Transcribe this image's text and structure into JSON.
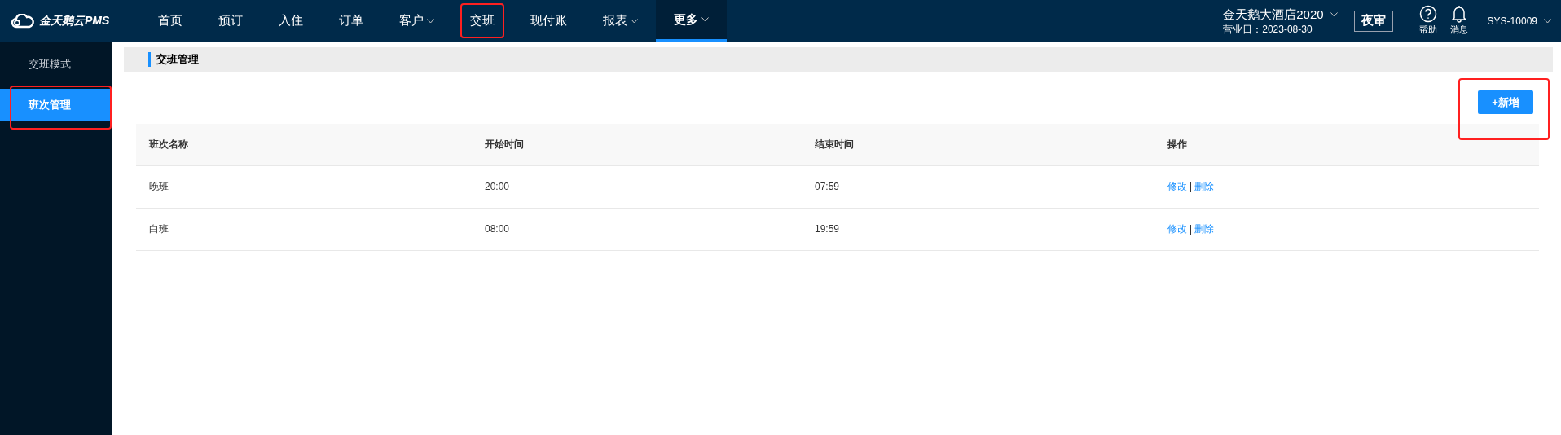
{
  "logo": {
    "text": "金天鹅云PMS"
  },
  "nav": [
    {
      "label": "首页",
      "selected": false,
      "dropdown": false,
      "annotated": false
    },
    {
      "label": "预订",
      "selected": false,
      "dropdown": false,
      "annotated": false
    },
    {
      "label": "入住",
      "selected": false,
      "dropdown": false,
      "annotated": false
    },
    {
      "label": "订单",
      "selected": false,
      "dropdown": false,
      "annotated": false
    },
    {
      "label": "客户",
      "selected": false,
      "dropdown": true,
      "annotated": false
    },
    {
      "label": "交班",
      "selected": false,
      "dropdown": false,
      "annotated": true
    },
    {
      "label": "现付账",
      "selected": false,
      "dropdown": false,
      "annotated": false
    },
    {
      "label": "报表",
      "selected": false,
      "dropdown": true,
      "annotated": false
    },
    {
      "label": "更多",
      "selected": true,
      "dropdown": true,
      "annotated": false
    }
  ],
  "hotel": {
    "name": "金天鹅大酒店2020",
    "business_day": "营业日：2023-08-30"
  },
  "night_audit_button": "夜审",
  "help": "帮助",
  "messages": "消息",
  "user": "SYS-10009",
  "sidebar": [
    {
      "label": "交班模式",
      "selected": false,
      "annotated": false
    },
    {
      "label": "班次管理",
      "selected": true,
      "annotated": true
    }
  ],
  "page_title": "交班管理",
  "add_button": {
    "label": "+新增",
    "annotated": true
  },
  "table": {
    "columns": [
      "班次名称",
      "开始时间",
      "结束时间",
      "操作"
    ],
    "rows": [
      {
        "name": "晚班",
        "start": "20:00",
        "end": "07:59",
        "actions": [
          "修改",
          "删除"
        ]
      },
      {
        "name": "白班",
        "start": "08:00",
        "end": "19:59",
        "actions": [
          "修改",
          "删除"
        ]
      }
    ]
  }
}
